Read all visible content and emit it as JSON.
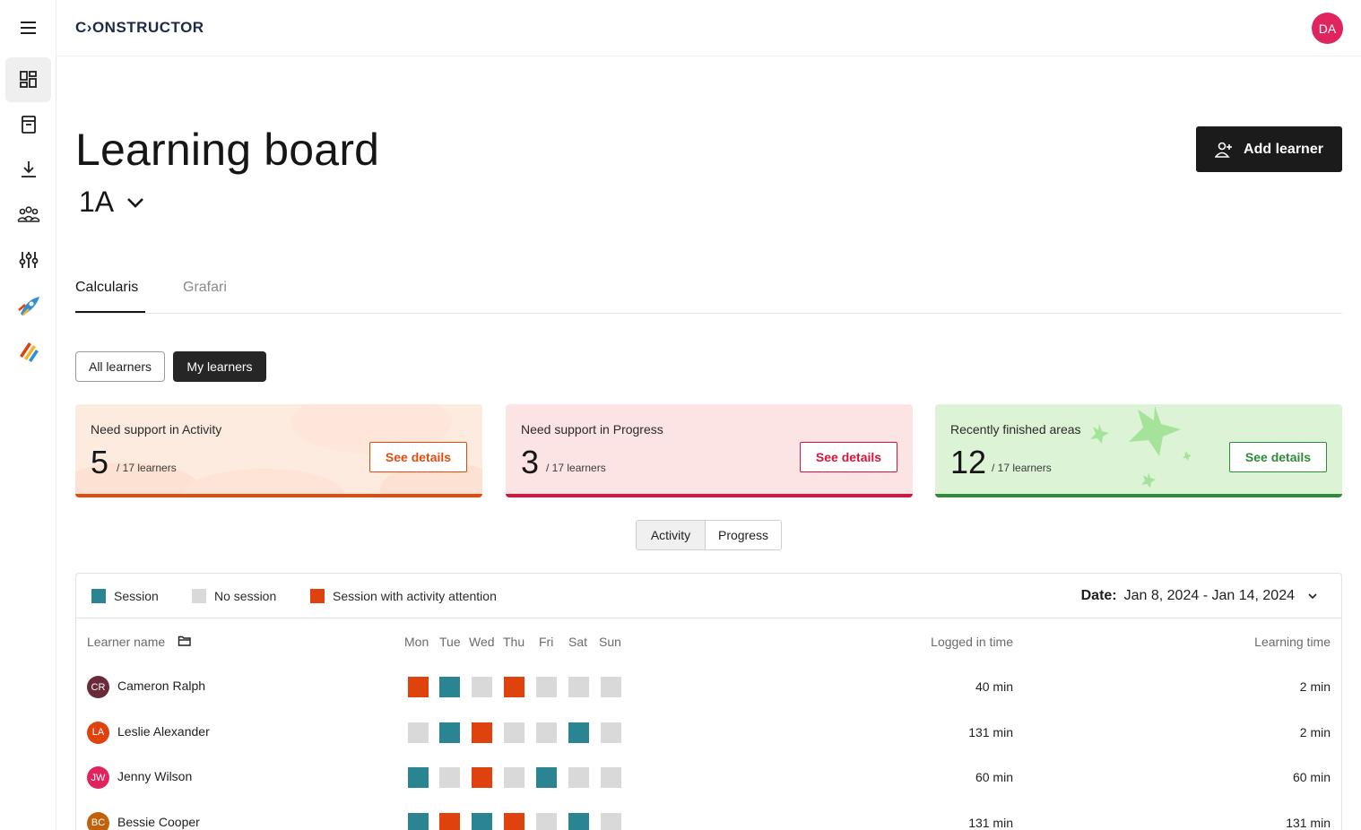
{
  "app": {
    "logo": "C›ONSTRUCTOR",
    "user_initials": "DA",
    "sidebar": [
      {
        "icon": "dashboard-icon"
      },
      {
        "icon": "book-icon"
      },
      {
        "icon": "download-icon"
      },
      {
        "icon": "group-icon"
      },
      {
        "icon": "sliders-icon"
      },
      {
        "icon": "rocket-app-icon"
      },
      {
        "icon": "pencils-app-icon"
      }
    ]
  },
  "header": {
    "title": "Learning board",
    "class_name": "1A",
    "add_button": "Add learner"
  },
  "tabs": [
    {
      "label": "Calcularis",
      "active": true
    },
    {
      "label": "Grafari",
      "active": false
    }
  ],
  "filters": {
    "all": "All learners",
    "mine": "My learners",
    "selected": "My learners"
  },
  "cards": [
    {
      "label": "Need support in Activity",
      "value": "5",
      "of": "/ 17 learners",
      "button": "See details",
      "color": "#e24b0f"
    },
    {
      "label": "Need support in Progress",
      "value": "3",
      "of": "/ 17 learners",
      "button": "See details",
      "color": "#d6143c"
    },
    {
      "label": "Recently finished areas",
      "value": "12",
      "of": "/ 17 learners",
      "button": "See details",
      "color": "#2f8a3a"
    }
  ],
  "view_toggle": {
    "activity": "Activity",
    "progress": "Progress",
    "selected": "Activity"
  },
  "legend": [
    {
      "label": "Session",
      "color": "#2b8491"
    },
    {
      "label": "No session",
      "color": "#d9d9d9"
    },
    {
      "label": "Session with activity attention",
      "color": "#e0420e"
    }
  ],
  "date_filter": {
    "label": "Date:",
    "value": "Jan 8, 2024 - Jan 14, 2024"
  },
  "table": {
    "headers": {
      "name": "Learner name",
      "days": [
        "Mon",
        "Tue",
        "Wed",
        "Thu",
        "Fri",
        "Sat",
        "Sun"
      ],
      "logged": "Logged in time",
      "learning": "Learning time"
    },
    "rows": [
      {
        "initials": "CR",
        "name": "Cameron Ralph",
        "avatar_color": "#6b2a3a",
        "days": [
          "attention",
          "session",
          "none",
          "attention",
          "none",
          "none",
          "none"
        ],
        "logged": "40 min",
        "learning": "2 min"
      },
      {
        "initials": "LA",
        "name": "Leslie Alexander",
        "avatar_color": "#e0420e",
        "days": [
          "none",
          "session",
          "attention",
          "none",
          "none",
          "session",
          "none"
        ],
        "logged": "131 min",
        "learning": "2 min"
      },
      {
        "initials": "JW",
        "name": "Jenny Wilson",
        "avatar_color": "#e0245e",
        "days": [
          "session",
          "none",
          "attention",
          "none",
          "session",
          "none",
          "none"
        ],
        "logged": "60 min",
        "learning": "60 min"
      },
      {
        "initials": "BC",
        "name": "Bessie Cooper",
        "avatar_color": "#c2610c",
        "days": [
          "session",
          "attention",
          "session",
          "attention",
          "none",
          "session",
          "none"
        ],
        "logged": "131 min",
        "learning": "131 min"
      }
    ]
  }
}
